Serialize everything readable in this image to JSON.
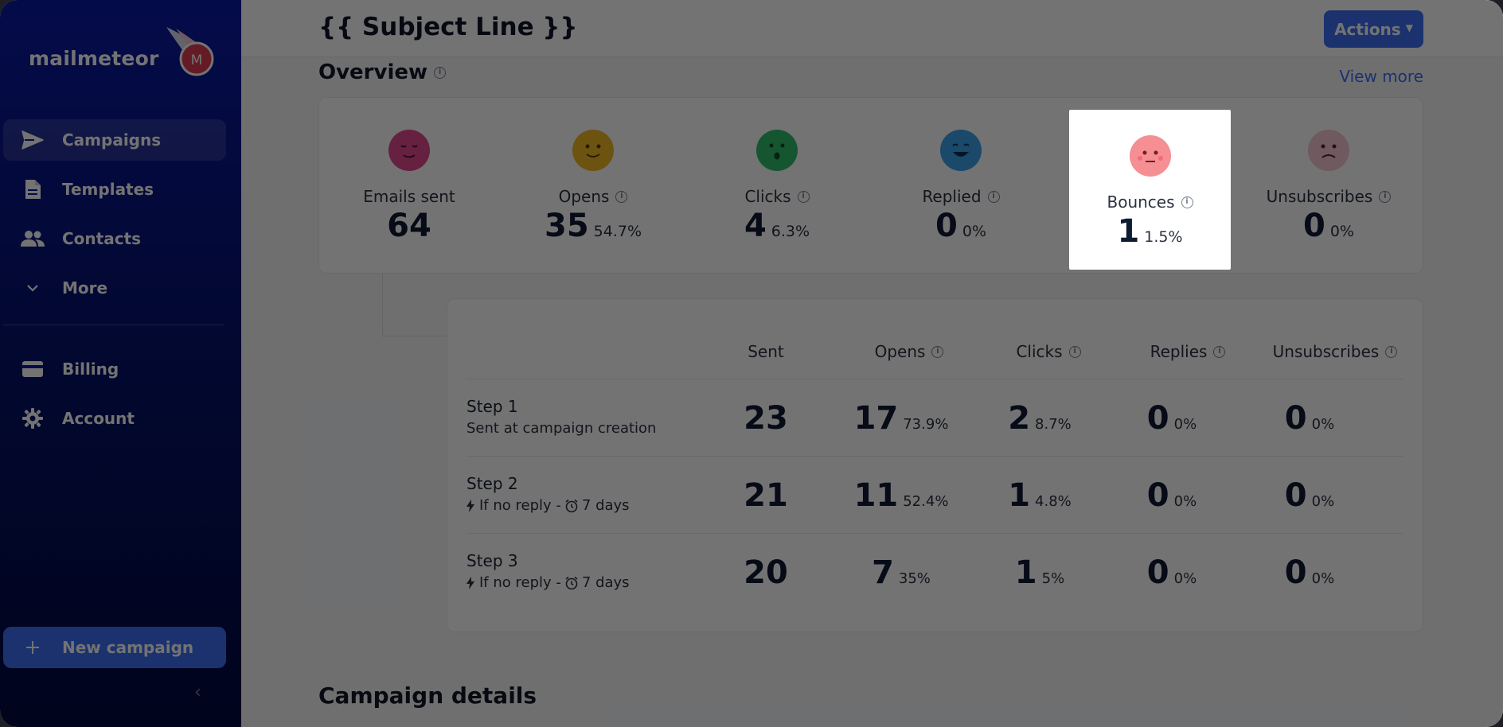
{
  "app": {
    "logo_text": "mailmeteor",
    "logo_mark_letter": "M"
  },
  "sidebar": {
    "items": [
      {
        "label": "Campaigns",
        "icon": "send-icon",
        "active": true
      },
      {
        "label": "Templates",
        "icon": "document-icon"
      },
      {
        "label": "Contacts",
        "icon": "people-icon"
      },
      {
        "label": "More",
        "icon": "chevron-down-icon"
      }
    ],
    "items2": [
      {
        "label": "Billing",
        "icon": "credit-card-icon"
      },
      {
        "label": "Account",
        "icon": "gear-icon"
      }
    ],
    "new_campaign_label": "New campaign",
    "collapse_glyph": "‹"
  },
  "header": {
    "subject": "{{ Subject Line }}",
    "actions_label": "Actions"
  },
  "overview": {
    "title": "Overview",
    "view_more": "View more",
    "stats": [
      {
        "label": "Emails sent",
        "value": "64",
        "pct": "",
        "info": false,
        "color": "#e24a8f"
      },
      {
        "label": "Opens",
        "value": "35",
        "pct": "54.7%",
        "info": true,
        "color": "#f2b824"
      },
      {
        "label": "Clicks",
        "value": "4",
        "pct": "6.3%",
        "info": true,
        "color": "#2fbf6d"
      },
      {
        "label": "Replied",
        "value": "0",
        "pct": "0%",
        "info": true,
        "color": "#3ba3e8"
      },
      {
        "label": "Bounces",
        "value": "1",
        "pct": "1.5%",
        "info": true,
        "color": "#f58f93"
      },
      {
        "label": "Unsubscribes",
        "value": "0",
        "pct": "0%",
        "info": true,
        "color": "#f3c8d2"
      }
    ]
  },
  "steps": {
    "headers": [
      "Sent",
      "Opens",
      "Clicks",
      "Replies",
      "Unsubscribes"
    ],
    "rows": [
      {
        "name": "Step 1",
        "sub": "Sent at campaign creation",
        "trigger": false,
        "sent": "23",
        "opens": "17",
        "opens_pct": "73.9%",
        "clicks": "2",
        "clicks_pct": "8.7%",
        "replies": "0",
        "replies_pct": "0%",
        "unsubs": "0",
        "unsubs_pct": "0%"
      },
      {
        "name": "Step 2",
        "sub": "If no reply - ",
        "delay": "7 days",
        "trigger": true,
        "sent": "21",
        "opens": "11",
        "opens_pct": "52.4%",
        "clicks": "1",
        "clicks_pct": "4.8%",
        "replies": "0",
        "replies_pct": "0%",
        "unsubs": "0",
        "unsubs_pct": "0%"
      },
      {
        "name": "Step 3",
        "sub": "If no reply - ",
        "delay": "7 days",
        "trigger": true,
        "sent": "20",
        "opens": "7",
        "opens_pct": "35%",
        "clicks": "1",
        "clicks_pct": "5%",
        "replies": "0",
        "replies_pct": "0%",
        "unsubs": "0",
        "unsubs_pct": "0%"
      }
    ]
  },
  "details": {
    "title": "Campaign details"
  },
  "colors": {
    "accent": "#3d6ff5",
    "sidebar_top": "#0b1aa3",
    "sidebar_bottom": "#030a3f"
  }
}
